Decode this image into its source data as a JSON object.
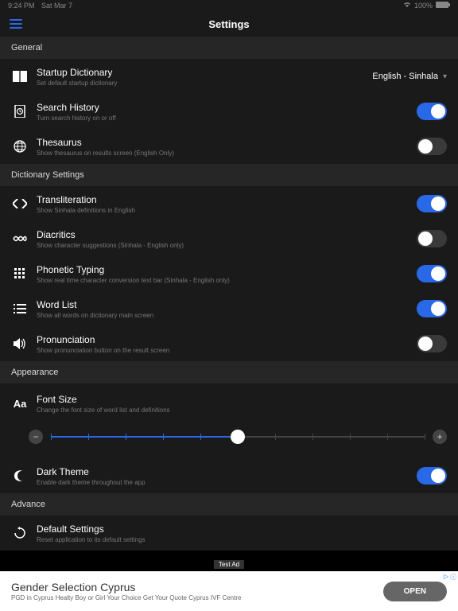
{
  "status": {
    "time": "9:24 PM",
    "date": "Sat Mar 7",
    "battery": "100%"
  },
  "header": {
    "title": "Settings"
  },
  "sections": {
    "general": {
      "label": "General",
      "startup": {
        "title": "Startup Dictionary",
        "desc": "Set default startup dictionary",
        "value": "English - Sinhala"
      },
      "history": {
        "title": "Search History",
        "desc": "Turn search history on or off",
        "on": true
      },
      "thesaurus": {
        "title": "Thesaurus",
        "desc": "Show thesaurus on results screen (English Only)",
        "on": false
      }
    },
    "dict": {
      "label": "Dictionary Settings",
      "translit": {
        "title": "Transliteration",
        "desc": "Show Sinhala definitions in English",
        "on": true
      },
      "diacritics": {
        "title": "Diacritics",
        "desc": "Show character suggestions (Sinhala - English only)",
        "on": false
      },
      "phonetic": {
        "title": "Phonetic Typing",
        "desc": "Show real time character conversion text bar (Sinhala - English only)",
        "on": true
      },
      "wordlist": {
        "title": "Word List",
        "desc": "Show all words on dictionary main screen",
        "on": true
      },
      "pronun": {
        "title": "Pronunciation",
        "desc": "Show pronunciation button on the result screen",
        "on": false
      }
    },
    "appearance": {
      "label": "Appearance",
      "fontsize": {
        "title": "Font Size",
        "desc": "Change the font size of word list and definitions",
        "value": 0.5
      },
      "dark": {
        "title": "Dark Theme",
        "desc": "Enable dark theme throughout the app",
        "on": true
      }
    },
    "advance": {
      "label": "Advance",
      "defaults": {
        "title": "Default Settings",
        "desc": "Reset application to its default settings"
      }
    }
  },
  "ad": {
    "label": "Test Ad",
    "title": "Gender Selection Cyprus",
    "desc": "PGD in Cyprus Healty Boy or Girl Your Choice Get Your Quote Cyprus IVF Centre",
    "cta": "OPEN"
  }
}
